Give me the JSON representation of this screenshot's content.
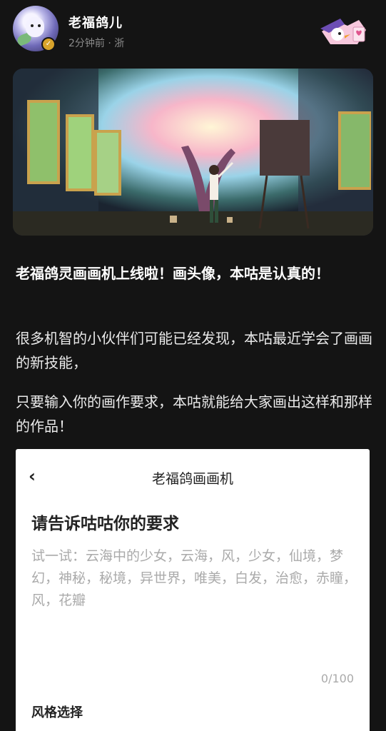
{
  "post": {
    "username": "老福鸽儿",
    "meta": "2分钟前 · 浙",
    "title": "老福鸽灵画画机上线啦！画头像，本咕是认真的！",
    "paragraph1": "很多机智的小伙伴们可能已经发现，本咕最近学会了画画的新技能，",
    "paragraph2": "只要输入你的画作要求，本咕就能给大家画出这样和那样的作品！"
  },
  "card": {
    "back_icon": "chevron-left-icon",
    "title": "老福鸽画画机",
    "prompt_heading": "请告诉咕咕你的要求",
    "placeholder": "试一试：云海中的少女，云海，风，少女，仙境，梦幻，神秘，秘境，异世界，唯美，白发，治愈，赤瞳，风，花瓣",
    "counter": "0/100",
    "style_label": "风格选择"
  },
  "colors": {
    "background": "#141414",
    "text_primary": "#ffffff",
    "text_secondary": "#8a8a8a",
    "card_bg": "#ffffff",
    "placeholder": "#aaaaaa"
  }
}
